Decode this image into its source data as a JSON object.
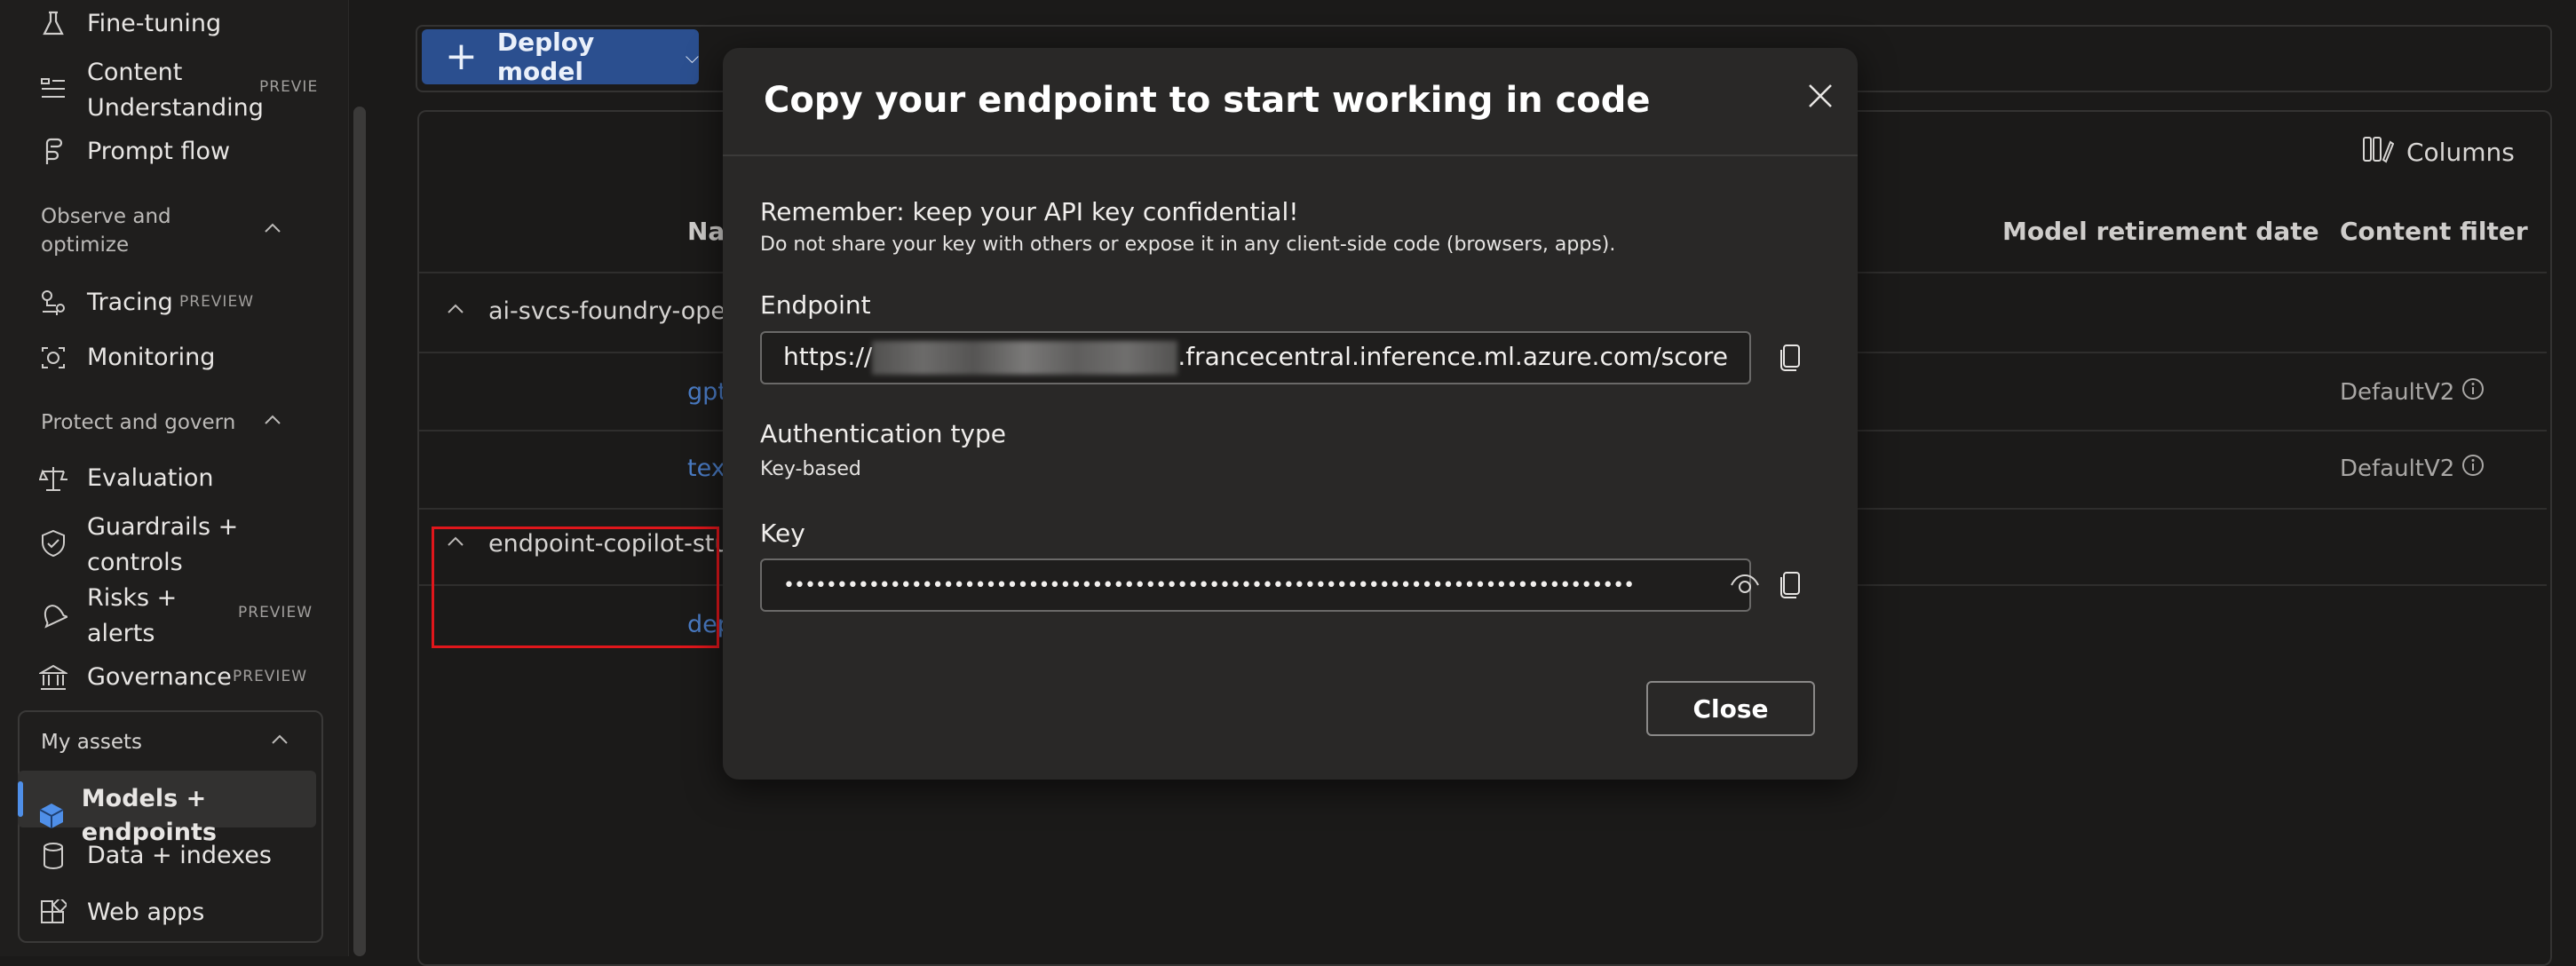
{
  "sidebar": {
    "items": [
      {
        "label": "Fine-tuning",
        "icon": "flask-icon"
      },
      {
        "label": "Content Understanding",
        "badge": "PREVIE",
        "icon": "content-understanding-icon"
      },
      {
        "label": "Prompt flow",
        "icon": "prompt-flow-icon"
      },
      {
        "label": "Tracing",
        "badge": "PREVIEW",
        "icon": "tracing-icon"
      },
      {
        "label": "Monitoring",
        "icon": "monitoring-icon"
      },
      {
        "label": "Evaluation",
        "icon": "scale-icon"
      },
      {
        "label": "Guardrails + controls",
        "icon": "shield-icon"
      },
      {
        "label": "Risks + alerts",
        "badge": "PREVIEW",
        "icon": "alert-icon"
      },
      {
        "label": "Governance",
        "badge": "PREVIEW",
        "icon": "bank-icon"
      },
      {
        "label": "Models + endpoints",
        "icon": "cube-icon",
        "active": true
      },
      {
        "label": "Data + indexes",
        "icon": "database-icon"
      },
      {
        "label": "Web apps",
        "icon": "apps-icon"
      }
    ],
    "groups": {
      "observe": "Observe and optimize",
      "protect": "Protect and govern",
      "assets": "My assets"
    }
  },
  "toolbar": {
    "deploy_label": "Deploy model"
  },
  "table": {
    "columns_label": "Columns",
    "headers": {
      "name": "Na",
      "retirement": "Model retirement date",
      "filter": "Content filter"
    },
    "groups": [
      {
        "name": "ai-svcs-foundry-oper",
        "rows": [
          {
            "name": "gpt",
            "filter": "DefaultV2"
          },
          {
            "name": "tex",
            "filter": "DefaultV2"
          }
        ]
      },
      {
        "name": "endpoint-copilot-stu",
        "rows": [
          {
            "name": "dep",
            "filter": ""
          }
        ]
      }
    ]
  },
  "modal": {
    "title": "Copy your endpoint to start working in code",
    "warning": "Remember: keep your API key confidential!",
    "warning_sub": "Do not share your key with others or expose it in any client-side code (browsers, apps).",
    "endpoint_label": "Endpoint",
    "endpoint_prefix": "https://",
    "endpoint_suffix": ".francecentral.inference.ml.azure.com/score",
    "auth_label": "Authentication type",
    "auth_value": "Key-based",
    "key_label": "Key",
    "key_value": "••••••••••••••••••••••••••••••••••••••••••••••••••••••••••••••••••••••••••••••••",
    "close_label": "Close"
  }
}
